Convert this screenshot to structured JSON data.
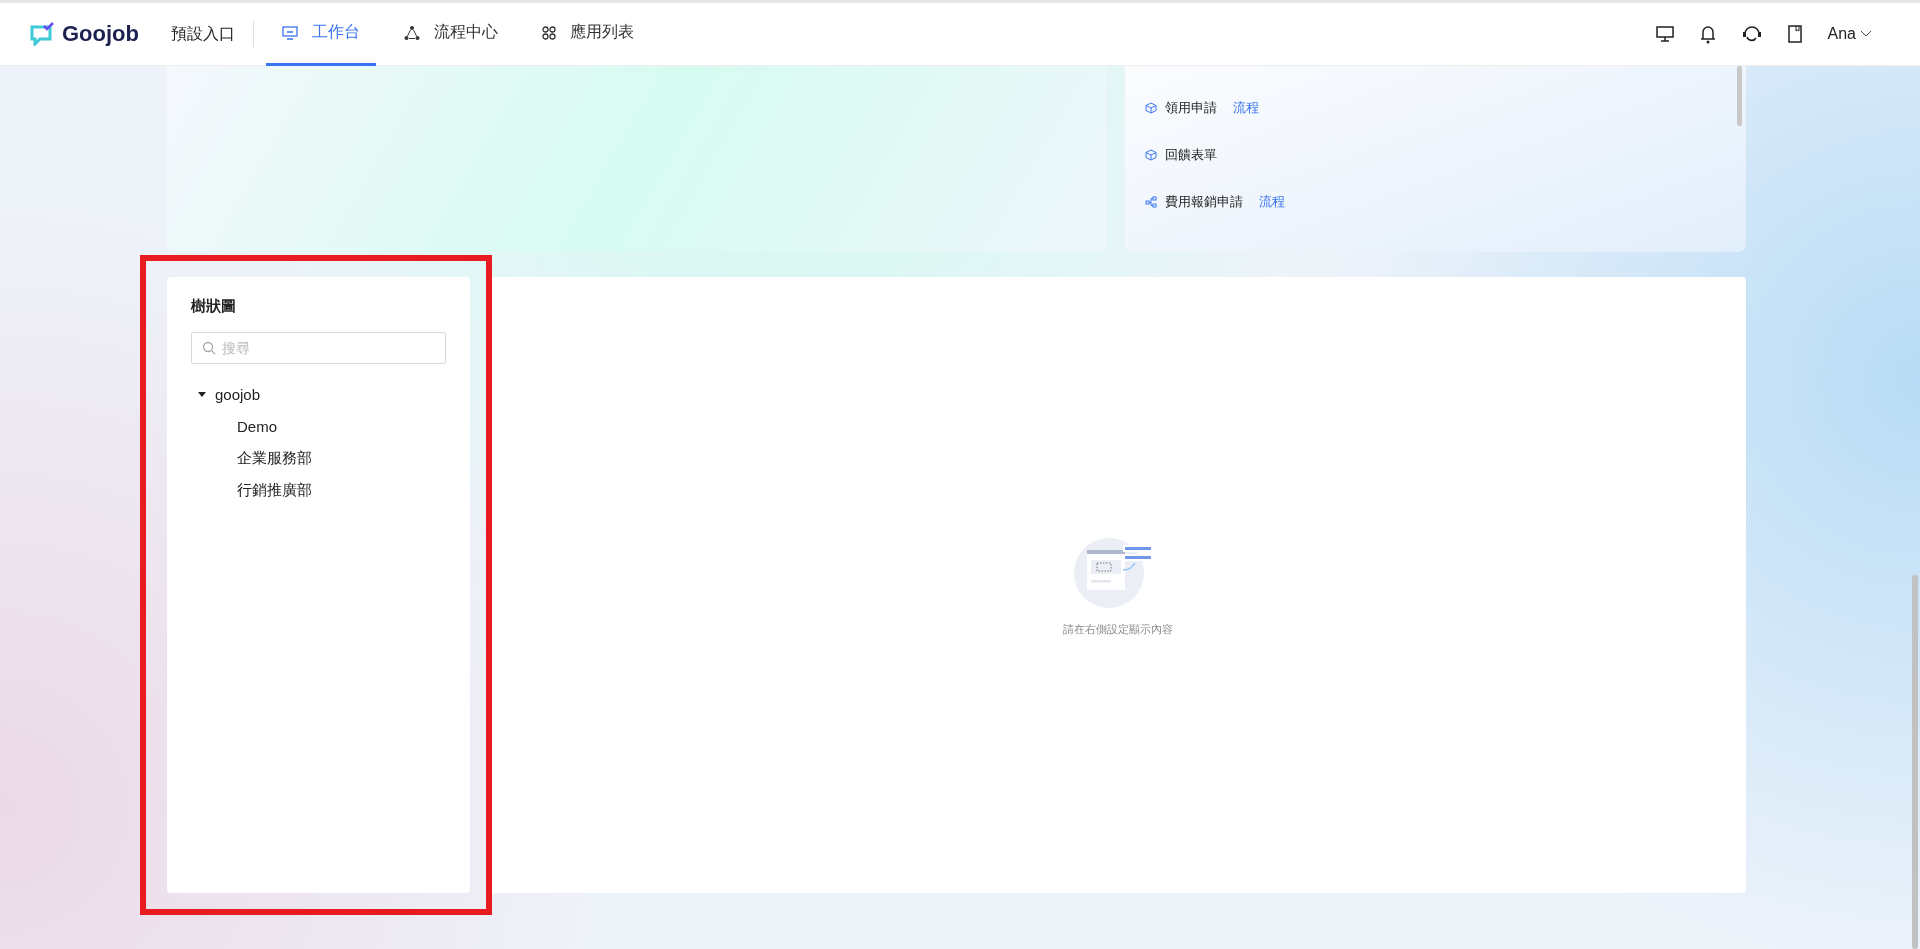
{
  "header": {
    "logo": "Goojob",
    "portal": "預設入口",
    "tabs": [
      {
        "label": "工作台",
        "kind": "monitor",
        "selected": true
      },
      {
        "label": "流程中心",
        "kind": "flow",
        "selected": false
      },
      {
        "label": "應用列表",
        "kind": "apps",
        "selected": false
      }
    ],
    "user": "Ana"
  },
  "app_list": [
    {
      "name": "領用申請",
      "kind": "form",
      "tag": "流程"
    },
    {
      "name": "回饋表單",
      "kind": "form"
    },
    {
      "name": "費用報銷申請",
      "kind": "workflow",
      "tag": "流程"
    }
  ],
  "tree_panel": {
    "title": "樹狀圖",
    "search": {
      "placeholder": "搜尋"
    },
    "tree": [
      {
        "label": "goojob",
        "expanded": true,
        "children": [
          {
            "label": "Demo"
          },
          {
            "label": "企業服務部"
          },
          {
            "label": "行銷推廣部"
          }
        ]
      }
    ]
  },
  "main_panel": {
    "empty_text": "請在右側設定顯示內容"
  }
}
